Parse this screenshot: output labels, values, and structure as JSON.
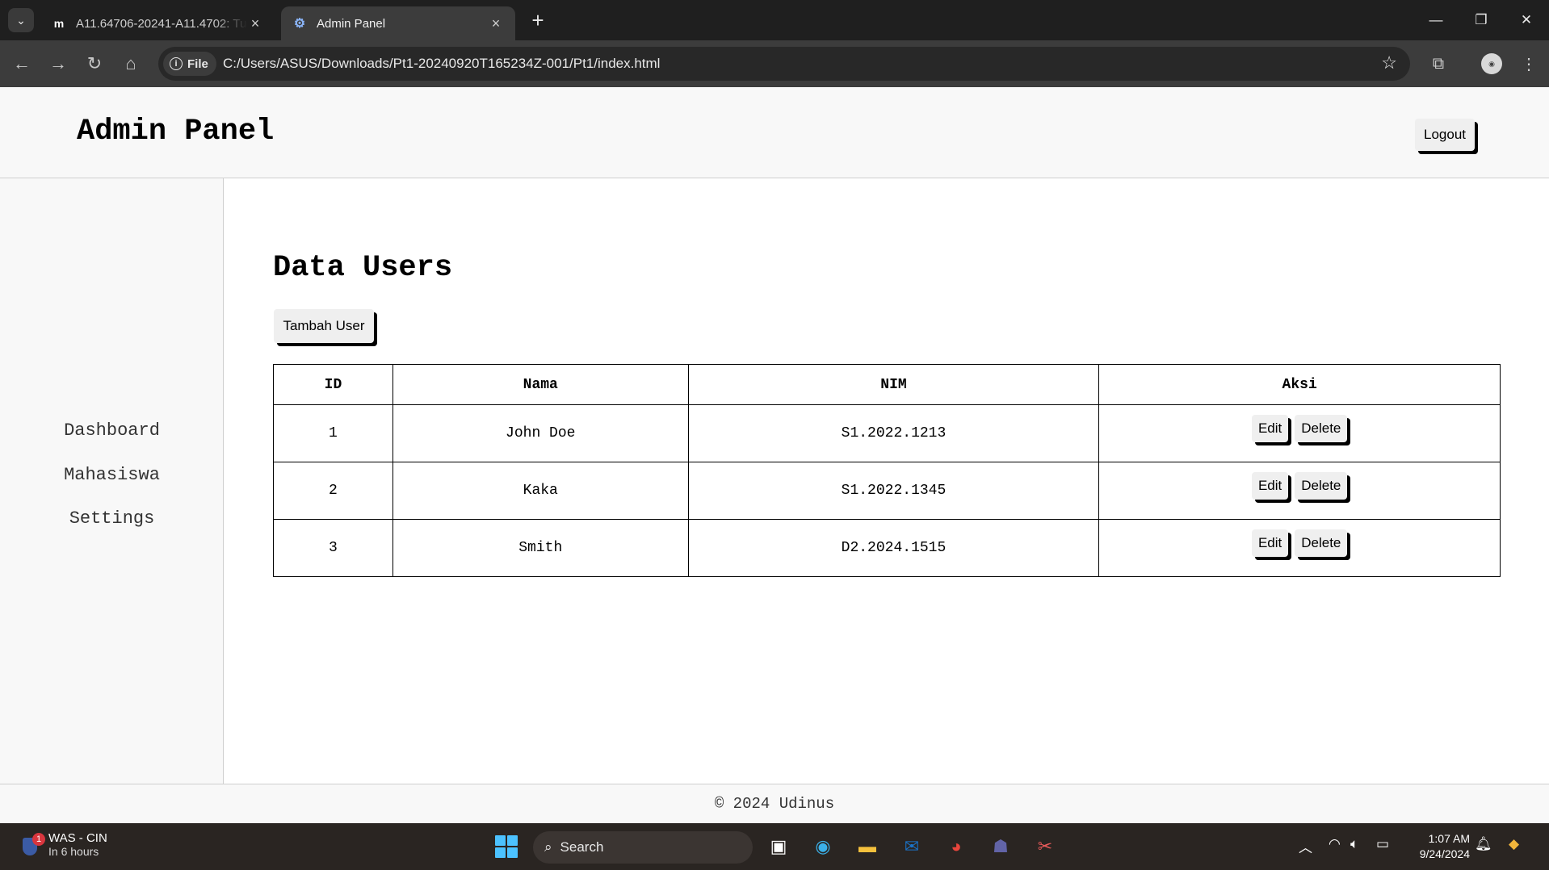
{
  "browser": {
    "tabs": [
      {
        "title": "A11.64706-20241-A11.4702: Tu"
      },
      {
        "title": "Admin Panel"
      }
    ],
    "scheme_chip": "File",
    "url": "C:/Users/ASUS/Downloads/Pt1-20240920T165234Z-001/Pt1/index.html"
  },
  "page": {
    "brand": "Admin Panel",
    "logout_label": "Logout",
    "sidebar": [
      {
        "label": "Dashboard"
      },
      {
        "label": "Mahasiswa"
      },
      {
        "label": "Settings"
      }
    ],
    "heading": "Data Users",
    "add_user_label": "Tambah User",
    "table": {
      "headers": [
        "ID",
        "Nama",
        "NIM",
        "Aksi"
      ],
      "rows": [
        {
          "id": "1",
          "nama": "John Doe",
          "nim": "S1.2022.1213"
        },
        {
          "id": "2",
          "nama": "Kaka",
          "nim": "S1.2022.1345"
        },
        {
          "id": "3",
          "nama": "Smith",
          "nim": "D2.2024.1515"
        }
      ],
      "edit_label": "Edit",
      "delete_label": "Delete"
    },
    "footer": "© 2024 Udinus"
  },
  "taskbar": {
    "weather": {
      "title": "WAS - CIN",
      "subtitle": "In 6 hours",
      "badge": "1"
    },
    "search_label": "Search",
    "time": "1:07 AM",
    "date": "9/24/2024"
  }
}
